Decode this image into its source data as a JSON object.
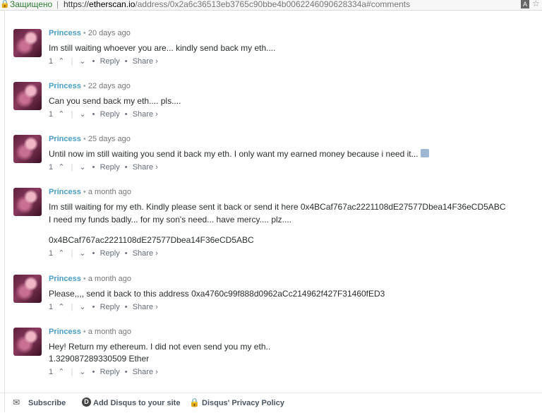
{
  "address_bar": {
    "secure_label": "Защищено",
    "separator": "|",
    "scheme": "https://",
    "host": "etherscan.io",
    "path": "/address/0x2a6c36513eb3765c90bbe4b0062246090628334a#comments"
  },
  "comments": [
    {
      "author": "Princess",
      "time": "20 days ago",
      "lines": [
        "Im still waiting whoever you are... kindly send back my eth...."
      ],
      "votes": "1",
      "reply": "Reply",
      "share": "Share ›"
    },
    {
      "author": "Princess",
      "time": "22 days ago",
      "lines": [
        "Can you send back my eth.... pls...."
      ],
      "votes": "1",
      "reply": "Reply",
      "share": "Share ›"
    },
    {
      "author": "Princess",
      "time": "25 days ago",
      "lines": [
        "Until now im still waiting you send it back my eth. I only want my earned money because i need it..."
      ],
      "votes": "1",
      "reply": "Reply",
      "share": "Share ›"
    },
    {
      "author": "Princess",
      "time": "a month ago",
      "lines": [
        "Im still waiting for my eth. Kindly please sent it back or send it here 0x4BCaf767ac2221108dE27577Dbea14F36eCD5ABC",
        "I need my funds badly... for my son's need... have mercy.... plz....",
        "0x4BCaf767ac2221108dE27577Dbea14F36eCD5ABC"
      ],
      "votes": "1",
      "reply": "Reply",
      "share": "Share ›"
    },
    {
      "author": "Princess",
      "time": "a month ago",
      "lines": [
        "Please,,,, send it back to this address 0xa4760c99f888d0962aCc214962f427F31460fED3"
      ],
      "votes": "1",
      "reply": "Reply",
      "share": "Share ›"
    },
    {
      "author": "Princess",
      "time": "a month ago",
      "lines": [
        "Hey! Return my ethereum. I did not even send you my eth..",
        "1.329087289330509 Ether"
      ],
      "votes": "1",
      "reply": "Reply",
      "share": "Share ›"
    }
  ],
  "footer": {
    "subscribe": "Subscribe",
    "add_disqus": "Add Disqus to your site",
    "privacy": "Disqus' Privacy Policy"
  },
  "icons": {
    "upvote": "chevron-up-icon",
    "downvote": "chevron-down-icon",
    "subscribe": "envelope-icon",
    "disqus": "disqus-logo-icon",
    "privacy": "lock-icon"
  },
  "colors": {
    "author": "#4a9ec7",
    "secure": "#2e7d32"
  }
}
